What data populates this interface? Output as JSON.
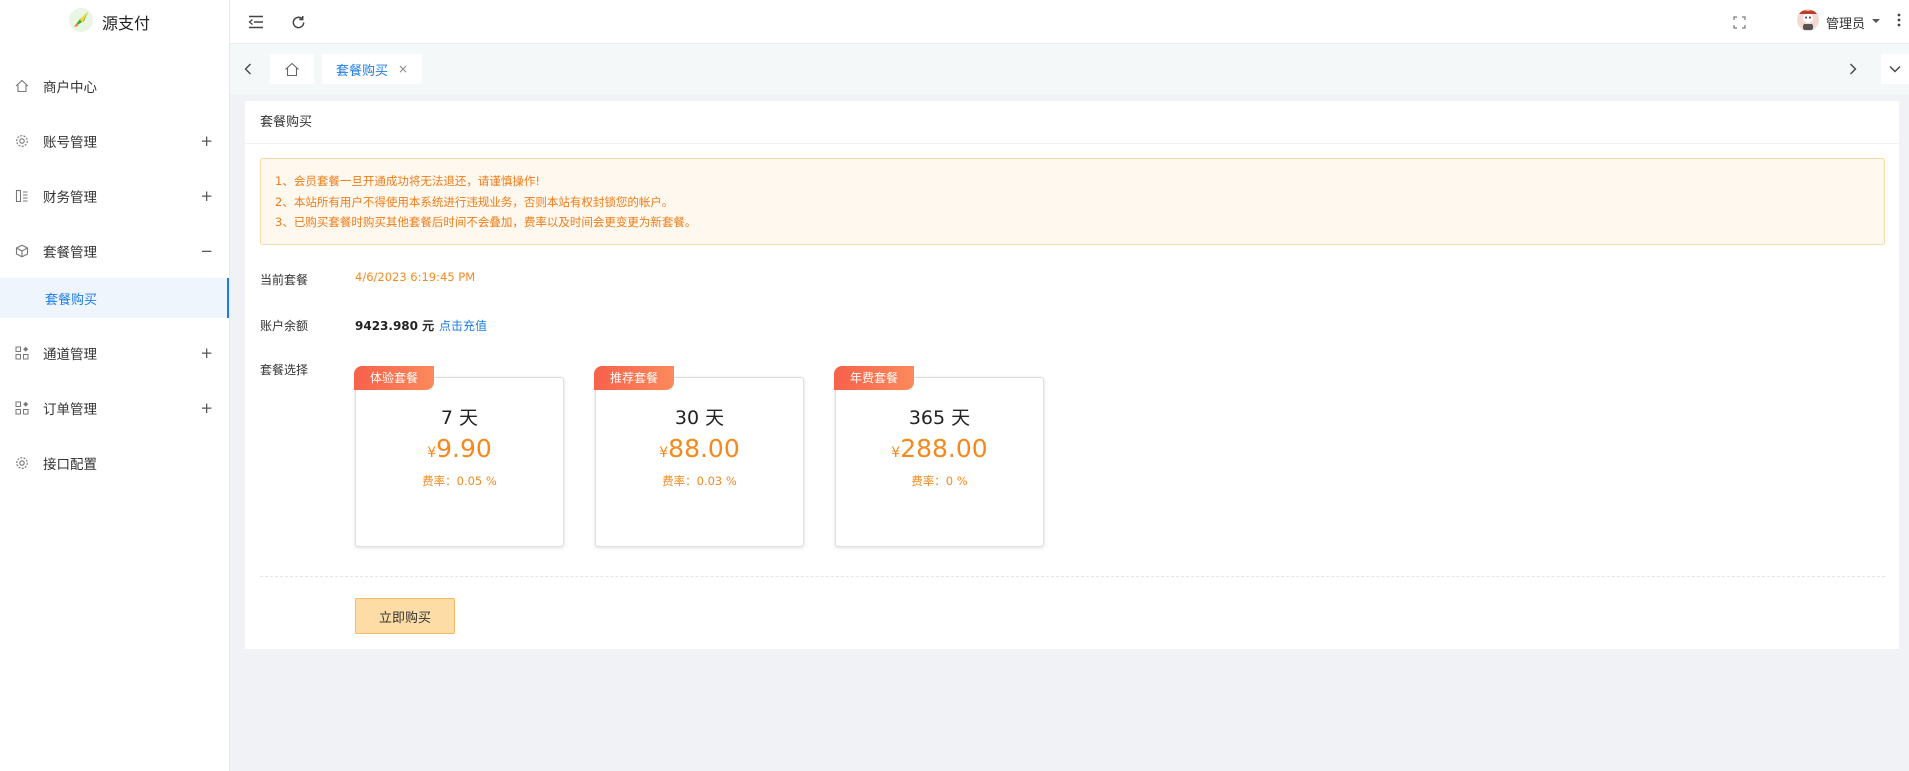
{
  "app": {
    "name": "源支付"
  },
  "sidebar": {
    "items": [
      {
        "label": "商户中心",
        "sign": "",
        "icon": "home-icon"
      },
      {
        "label": "账号管理",
        "sign": "+",
        "icon": "gear-icon"
      },
      {
        "label": "财务管理",
        "sign": "+",
        "icon": "ledger-icon"
      },
      {
        "label": "套餐管理",
        "sign": "−",
        "icon": "cube-icon"
      },
      {
        "label": "通道管理",
        "sign": "+",
        "icon": "grid-icon"
      },
      {
        "label": "订单管理",
        "sign": "+",
        "icon": "grid-icon"
      },
      {
        "label": "接口配置",
        "sign": "",
        "icon": "gear-icon"
      }
    ],
    "sub_item": {
      "label": "套餐购买"
    }
  },
  "header": {
    "user": "管理员"
  },
  "tabs": {
    "active": {
      "label": "套餐购买",
      "close": "×"
    }
  },
  "card": {
    "title": "套餐购买",
    "notices": [
      "1、会员套餐一旦开通成功将无法退还，请谨慎操作!",
      "2、本站所有用户不得使用本系统进行违规业务，否则本站有权封锁您的帐户。",
      "3、已购买套餐时购买其他套餐后时间不会叠加，费率以及时间会更变更为新套餐。"
    ],
    "current_label": "当前套餐",
    "current_value": "4/6/2023 6:19:45 PM",
    "balance_label": "账户余额",
    "balance_value": "9423.980 元",
    "recharge_link": "点击充值",
    "choose_label": "套餐选择",
    "packages": [
      {
        "badge": "体验套餐",
        "days": "7 天",
        "currency": "¥",
        "price": "9.90",
        "rate": "费率：0.05 %"
      },
      {
        "badge": "推荐套餐",
        "days": "30 天",
        "currency": "¥",
        "price": "88.00",
        "rate": "费率：0.03 %"
      },
      {
        "badge": "年费套餐",
        "days": "365 天",
        "currency": "¥",
        "price": "288.00",
        "rate": "费率：0 %"
      }
    ],
    "buy_button": "立即购买"
  },
  "colors": {
    "accent": "#1e7ce6",
    "warning": "#f5891d",
    "badge": "#f6614a"
  }
}
